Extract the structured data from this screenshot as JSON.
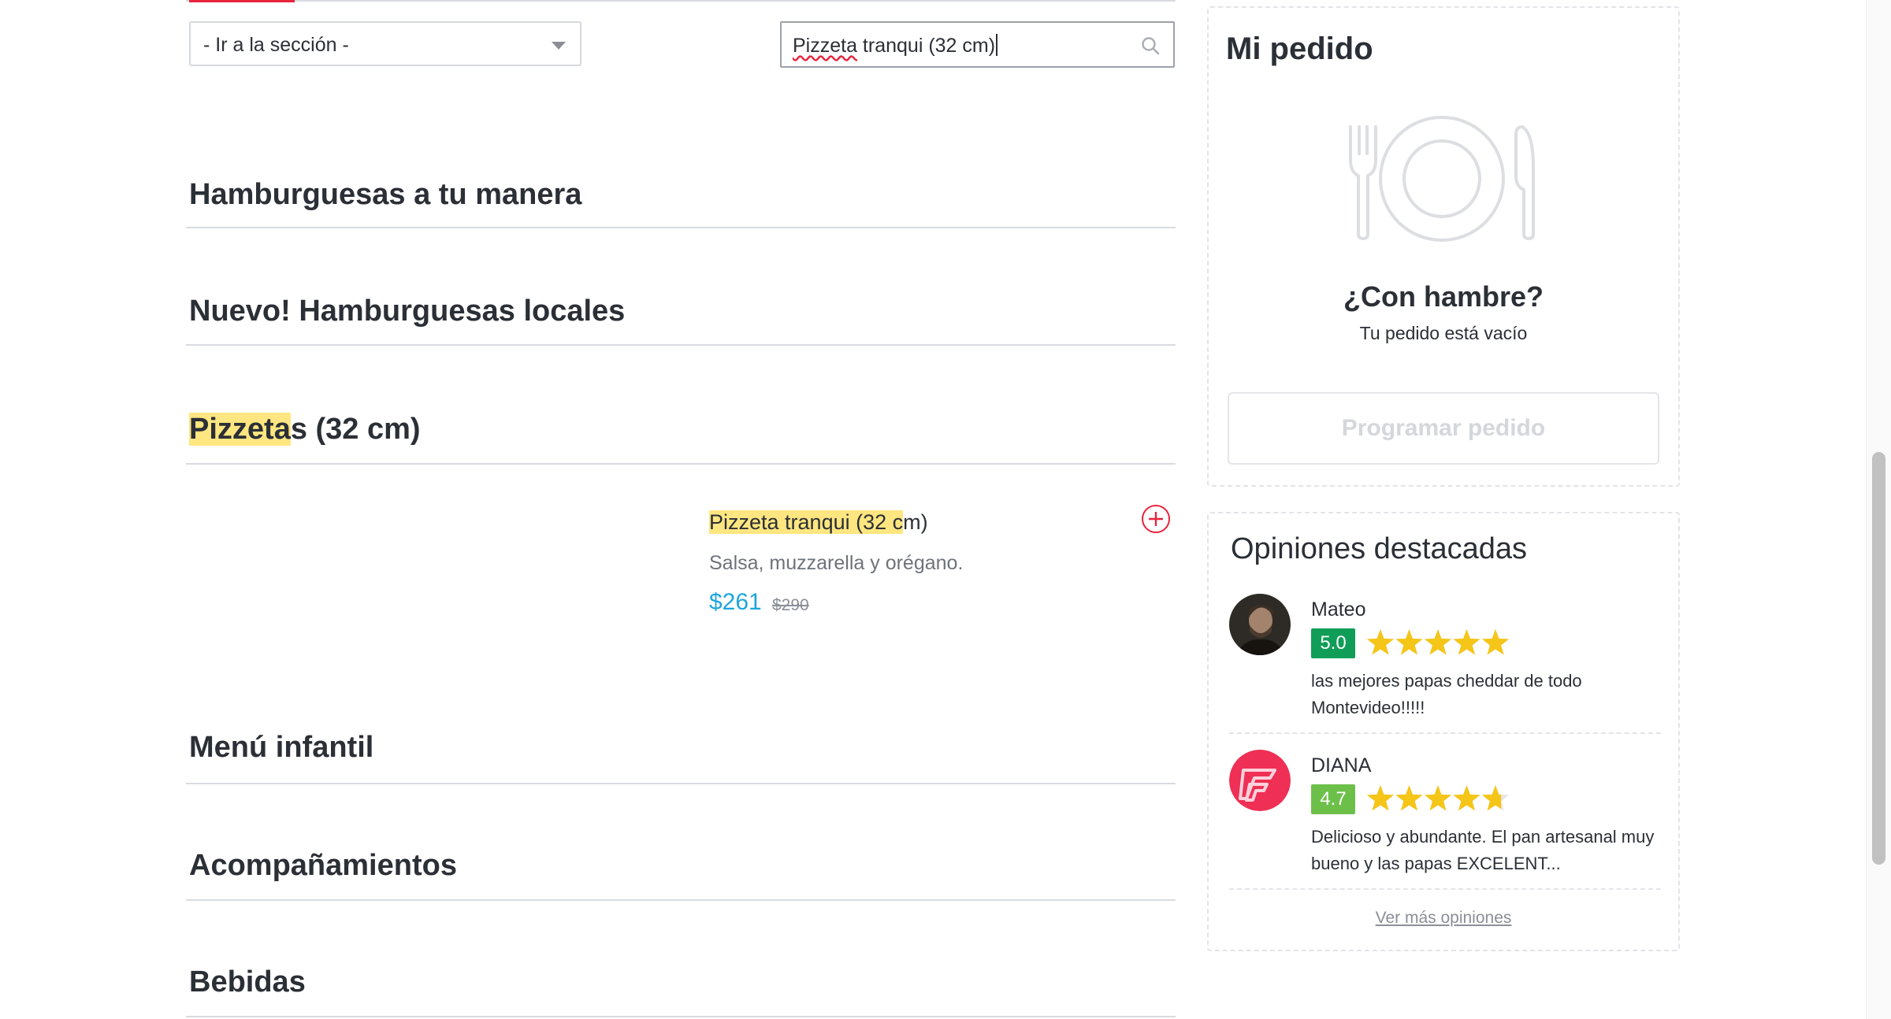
{
  "toolbar": {
    "section_select": "- Ir a la sección -",
    "search": {
      "value": "Pizzeta tranqui (32 cm)",
      "value_misspelled_part": "Pizzeta",
      "value_rest": " tranqui (32 cm)",
      "placeholder": ""
    }
  },
  "menu": {
    "categories": [
      {
        "title": "Hamburguesas a tu manera"
      },
      {
        "title": "Nuevo! Hamburguesas locales"
      },
      {
        "title_highlight": "Pizzeta",
        "title_rest": "s (32 cm)"
      },
      {
        "title": "Menú infantil"
      },
      {
        "title": "Acompañamientos"
      },
      {
        "title": "Bebidas"
      }
    ],
    "product": {
      "name_highlight": "Pizzeta tranqui (32 c",
      "name_rest": "m)",
      "description": "Salsa, muzzarella y orégano.",
      "price": "$261",
      "old_price": "$290"
    }
  },
  "order": {
    "title": "Mi pedido",
    "empty_title": "¿Con hambre?",
    "empty_subtitle": "Tu pedido está vacío",
    "schedule_button": "Programar pedido"
  },
  "reviews": {
    "title": "Opiniones destacadas",
    "items": [
      {
        "name": "Mateo",
        "rating": "5.0",
        "rating_value": 5.0,
        "text": "las mejores papas cheddar de todo Montevideo!!!!!",
        "badge_color": "#0f9d58"
      },
      {
        "name": "DIANA",
        "rating": "4.7",
        "rating_value": 4.7,
        "text": "Delicioso y abundante. El pan artesanal muy bueno y las papas EXCELENT...",
        "badge_color": "#6cc04a"
      }
    ],
    "more_link": "Ver más opiniones"
  },
  "colors": {
    "accent_red": "#e8243f",
    "price_blue": "#1ea6de",
    "highlight_yellow": "#ffe680",
    "star_yellow": "#f5c518"
  }
}
